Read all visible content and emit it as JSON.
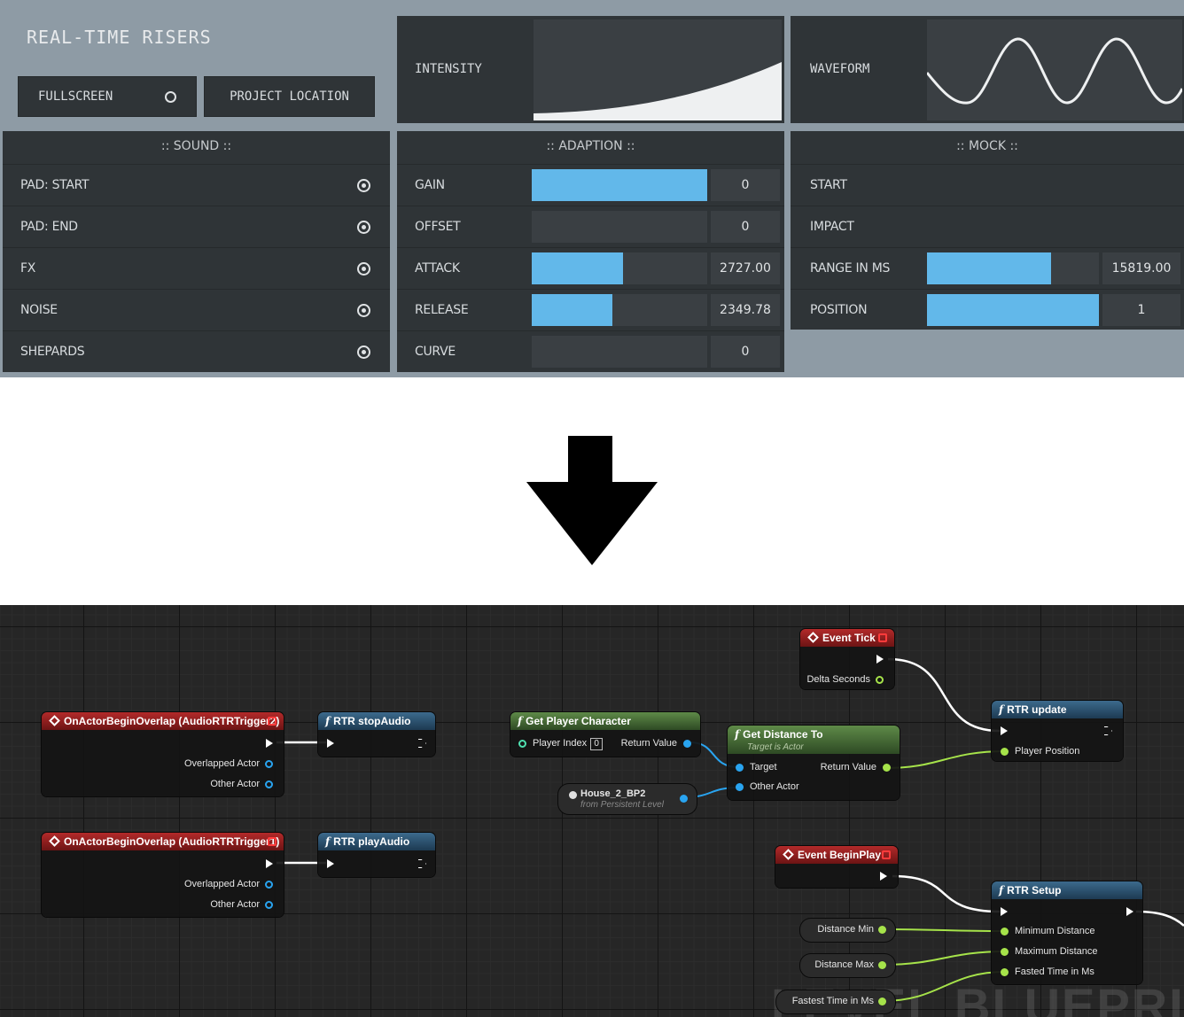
{
  "app": {
    "title": "REAL-TIME RISERS",
    "buttons": {
      "fullscreen": "FULLSCREEN",
      "project_location": "PROJECT LOCATION"
    }
  },
  "graphs": {
    "intensity": {
      "label": "INTENSITY"
    },
    "waveform": {
      "label": "WAVEFORM"
    }
  },
  "sound": {
    "header": ":: SOUND ::",
    "items": [
      {
        "label": "PAD: START"
      },
      {
        "label": "PAD: END"
      },
      {
        "label": "FX"
      },
      {
        "label": "NOISE"
      },
      {
        "label": "SHEPARDS"
      }
    ]
  },
  "adaption": {
    "header": ":: ADAPTION ::",
    "items": [
      {
        "label": "GAIN",
        "value": "0",
        "fill": 1.0
      },
      {
        "label": "OFFSET",
        "value": "0",
        "fill": 0.0
      },
      {
        "label": "ATTACK",
        "value": "2727.00",
        "fill": 0.52
      },
      {
        "label": "RELEASE",
        "value": "2349.78",
        "fill": 0.46
      },
      {
        "label": "CURVE",
        "value": "0",
        "fill": 0.0
      }
    ]
  },
  "mock": {
    "header": ":: MOCK ::",
    "items": [
      {
        "label": "START"
      },
      {
        "label": "IMPACT"
      },
      {
        "label": "RANGE IN MS",
        "value": "15819.00",
        "fill": 0.72
      },
      {
        "label": "POSITION",
        "value": "1",
        "fill": 1.0
      }
    ]
  },
  "blueprint": {
    "watermark": "LEVEL BLUEPRINT",
    "nodes": {
      "overlap2": {
        "title": "OnActorBeginOverlap (AudioRTRTrigger2)",
        "pin1": "Overlapped Actor",
        "pin2": "Other Actor"
      },
      "overlap1": {
        "title": "OnActorBeginOverlap (AudioRTRTrigger1)",
        "pin1": "Overlapped Actor",
        "pin2": "Other Actor"
      },
      "stop_audio": {
        "title": "RTR stopAudio"
      },
      "play_audio": {
        "title": "RTR playAudio"
      },
      "get_player": {
        "title": "Get Player Character",
        "pin_in": "Player Index",
        "index": "0",
        "pin_out": "Return Value"
      },
      "house_var": {
        "title": "House_2_BP2",
        "sub": "from Persistent Level"
      },
      "get_distance": {
        "title": "Get Distance To",
        "sub": "Target is Actor",
        "target": "Target",
        "other": "Other Actor",
        "ret": "Return Value"
      },
      "event_tick": {
        "title": "Event Tick",
        "pin": "Delta Seconds"
      },
      "rtr_update": {
        "title": "RTR update",
        "pin": "Player Position"
      },
      "event_begin": {
        "title": "Event BeginPlay"
      },
      "rtr_setup": {
        "title": "RTR Setup",
        "pin1": "Minimum Distance",
        "pin2": "Maximum Distance",
        "pin3": "Fasted Time in Ms"
      },
      "dist_min": {
        "title": "Distance Min"
      },
      "dist_max": {
        "title": "Distance Max"
      },
      "fastest": {
        "title": "Fastest Time in Ms"
      }
    }
  },
  "colors": {
    "accent_blue": "#62b8ea",
    "panel": "#2f3437",
    "bg": "#8e9ba5",
    "pin_green": "#a6e34a",
    "pin_blue": "#29a4f0"
  }
}
